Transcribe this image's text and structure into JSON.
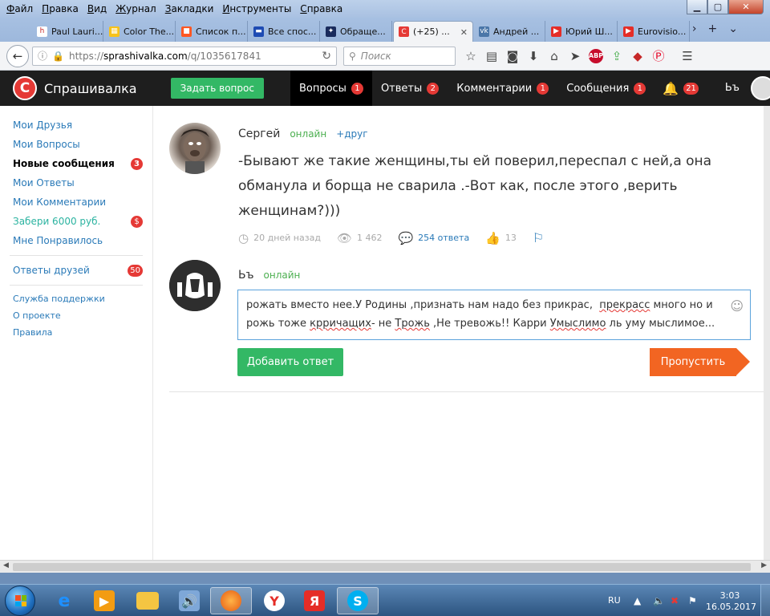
{
  "menu": [
    "Файл",
    "Правка",
    "Вид",
    "Журнал",
    "Закладки",
    "Инструменты",
    "Справка"
  ],
  "tabs": [
    {
      "label": "Paul Lauri...",
      "color": "#ffffff",
      "glyph": "h"
    },
    {
      "label": "Color The...",
      "color": "#f7c21a",
      "glyph": "▦"
    },
    {
      "label": "Список п...",
      "color": "#ff5722",
      "glyph": "■"
    },
    {
      "label": "Все спос...",
      "color": "#1e4bb3",
      "glyph": "▬"
    },
    {
      "label": "Обраще...",
      "color": "#1a2b5c",
      "glyph": "✦"
    },
    {
      "label": "(+25) ...",
      "color": "#e53935",
      "glyph": "C",
      "active": true
    },
    {
      "label": "Андрей ...",
      "color": "#4a76a8",
      "glyph": "vk"
    },
    {
      "label": "Юрий Ш...",
      "color": "#e52d27",
      "glyph": "▶"
    },
    {
      "label": "Eurovisio...",
      "color": "#e52d27",
      "glyph": "▶"
    }
  ],
  "url": {
    "scheme": "https://",
    "host": "sprashivalka.com",
    "path": "/q/1035617841"
  },
  "search_placeholder": "Поиск",
  "site": {
    "logo_letter": "C",
    "name": "Спрашивалка",
    "ask_button": "Задать вопрос",
    "nav": [
      {
        "label": "Вопросы",
        "count": "1",
        "active": true
      },
      {
        "label": "Ответы",
        "count": "2"
      },
      {
        "label": "Комментарии",
        "count": "1"
      },
      {
        "label": "Сообщения",
        "count": "1"
      }
    ],
    "notifications_count": "21",
    "user_nick": "Ьъ"
  },
  "sidebar": {
    "items": [
      {
        "label": "Мои Друзья"
      },
      {
        "label": "Мои Вопросы"
      },
      {
        "label": "Новые сообщения",
        "badge": "3",
        "bold": true
      },
      {
        "label": "Мои Ответы"
      },
      {
        "label": "Мои Комментарии"
      },
      {
        "label": "Забери 6000 руб.",
        "badge": "$",
        "green": true
      },
      {
        "label": "Мне Понравилось"
      }
    ],
    "friends_answers": {
      "label": "Ответы друзей",
      "badge": "50"
    },
    "footer_links": [
      "Служба поддержки",
      "О проекте",
      "Правила"
    ]
  },
  "question": {
    "author": "Сергей",
    "status": "онлайн",
    "add_friend": "+друг",
    "text": "-Бывают же такие женщины,ты ей поверил,переспал с ней,а она обманула и борща не сварила .-Вот как, после этого ,верить женщинам?)))",
    "time": "20 дней назад",
    "views": "1 462",
    "answers": "254 ответа",
    "likes": "13"
  },
  "answer_form": {
    "author": "Ьъ",
    "status": "онлайн",
    "submit_label": "Добавить ответ",
    "skip_label": "Пропустить"
  },
  "taskbar": {
    "lang": "RU",
    "time": "3:03",
    "date": "16.05.2017"
  }
}
